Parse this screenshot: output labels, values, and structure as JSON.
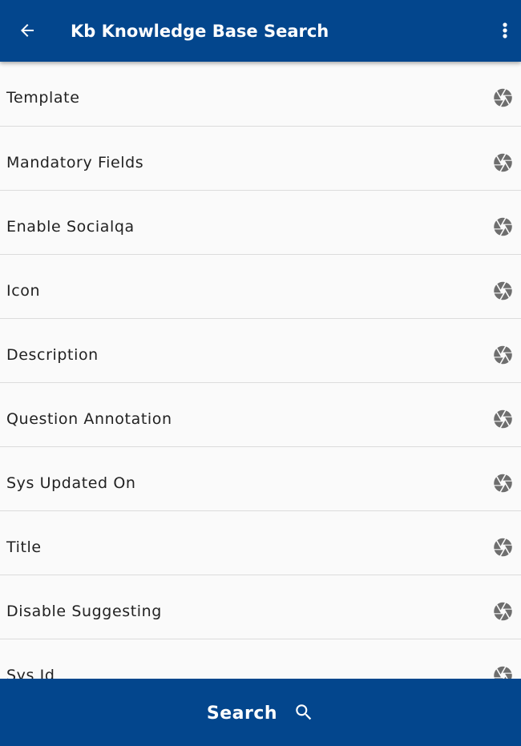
{
  "header": {
    "title": "Kb Knowledge Base Search",
    "back_icon": "arrow-left-icon",
    "menu_icon": "more-vert-icon",
    "background_color": "#03468d"
  },
  "fields": [
    {
      "label": "Template",
      "icon": "aperture-icon"
    },
    {
      "label": "Mandatory Fields",
      "icon": "aperture-icon"
    },
    {
      "label": "Enable Socialqa",
      "icon": "aperture-icon"
    },
    {
      "label": "Icon",
      "icon": "aperture-icon"
    },
    {
      "label": "Description",
      "icon": "aperture-icon"
    },
    {
      "label": "Question Annotation",
      "icon": "aperture-icon"
    },
    {
      "label": "Sys Updated On",
      "icon": "aperture-icon"
    },
    {
      "label": "Title",
      "icon": "aperture-icon"
    },
    {
      "label": "Disable Suggesting",
      "icon": "aperture-icon"
    },
    {
      "label": "Sys Id",
      "icon": "aperture-icon"
    }
  ],
  "footer": {
    "search_label": "Search",
    "search_icon": "search-icon",
    "background_color": "#03468d"
  }
}
